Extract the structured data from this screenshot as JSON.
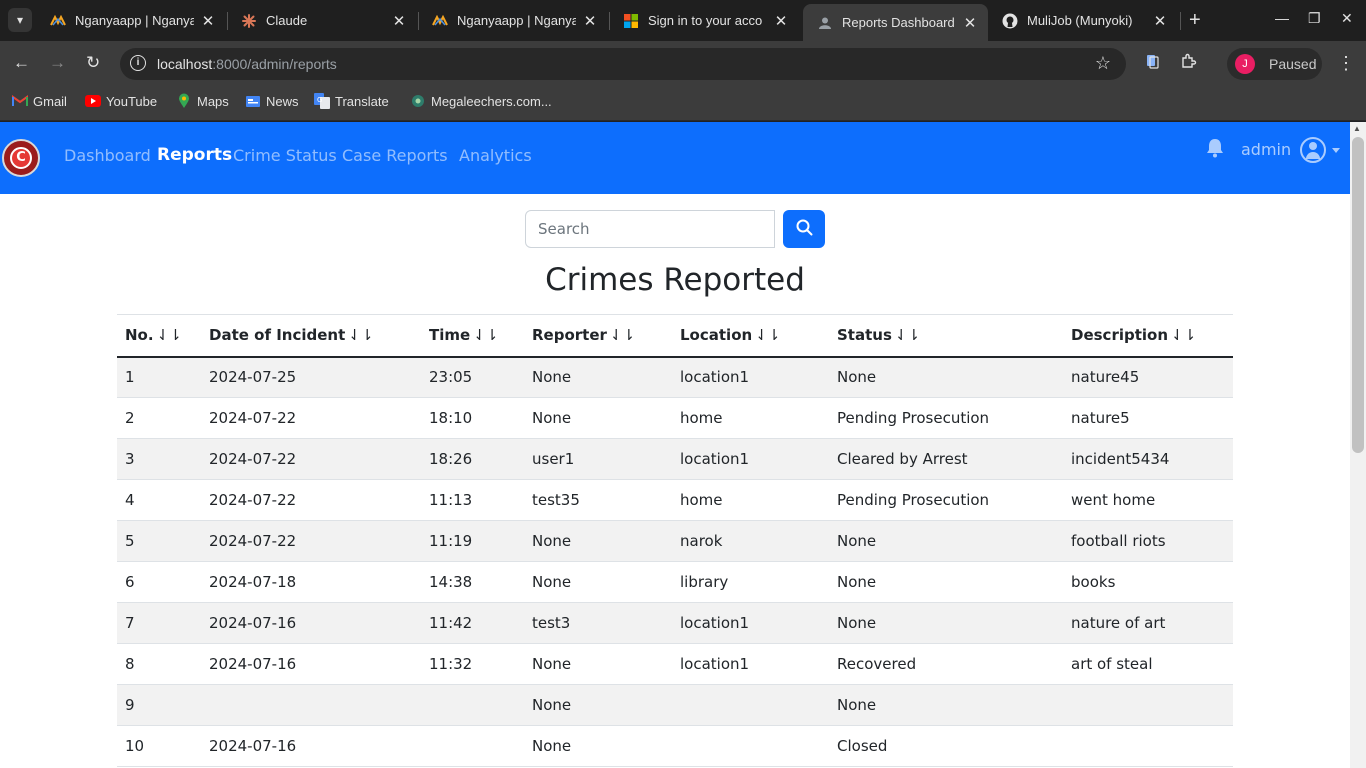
{
  "browser": {
    "tabs": [
      {
        "title": "Nganyaapp | Nganya",
        "favicon": "nganya-icon",
        "active": false
      },
      {
        "title": "Claude",
        "favicon": "claude-icon",
        "active": false
      },
      {
        "title": "Nganyaapp | Nganya",
        "favicon": "nganya-icon",
        "active": false
      },
      {
        "title": "Sign in to your acco",
        "favicon": "microsoft-icon",
        "active": false
      },
      {
        "title": "Reports Dashboard",
        "favicon": "page-icon",
        "active": true
      },
      {
        "title": "MuliJob (Munyoki)",
        "favicon": "github-icon",
        "active": false
      }
    ],
    "url_host": "localhost",
    "url_path": ":8000/admin/reports",
    "profile_initial": "J",
    "profile_label": "Paused",
    "bookmarks": [
      {
        "label": "Gmail",
        "icon": "gmail-icon"
      },
      {
        "label": "YouTube",
        "icon": "youtube-icon"
      },
      {
        "label": "Maps",
        "icon": "maps-icon"
      },
      {
        "label": "News",
        "icon": "news-icon"
      },
      {
        "label": "Translate",
        "icon": "translate-icon"
      },
      {
        "label": "Megaleechers.com...",
        "icon": "megaleechers-icon"
      }
    ]
  },
  "navbar": {
    "logo_letter": "C",
    "links": [
      "Dashboard",
      "Reports",
      "Crime Status",
      "Case Reports",
      "Analytics"
    ],
    "active_link": "Reports",
    "username": "admin",
    "brand_color": "#0d6efd"
  },
  "search": {
    "placeholder": "Search"
  },
  "page": {
    "heading": "Crimes Reported"
  },
  "table": {
    "columns": [
      "No.",
      "Date of Incident",
      "Time",
      "Reporter",
      "Location",
      "Status",
      "Description"
    ],
    "sort_glyph": "⇃⇂",
    "rows": [
      [
        "1",
        "2024-07-25",
        "23:05",
        "None",
        "location1",
        "None",
        "nature45"
      ],
      [
        "2",
        "2024-07-22",
        "18:10",
        "None",
        "home",
        "Pending Prosecution",
        "nature5"
      ],
      [
        "3",
        "2024-07-22",
        "18:26",
        "user1",
        "location1",
        "Cleared by Arrest",
        "incident5434"
      ],
      [
        "4",
        "2024-07-22",
        "11:13",
        "test35",
        "home",
        "Pending Prosecution",
        "went home"
      ],
      [
        "5",
        "2024-07-22",
        "11:19",
        "None",
        "narok",
        "None",
        "football riots"
      ],
      [
        "6",
        "2024-07-18",
        "14:38",
        "None",
        "library",
        "None",
        "books"
      ],
      [
        "7",
        "2024-07-16",
        "11:42",
        "test3",
        "location1",
        "None",
        "nature of art"
      ],
      [
        "8",
        "2024-07-16",
        "11:32",
        "None",
        "location1",
        "Recovered",
        "art of steal"
      ],
      [
        "9",
        "",
        "",
        "None",
        "",
        "None",
        ""
      ],
      [
        "10",
        "2024-07-16",
        "",
        "None",
        "",
        "Closed",
        ""
      ]
    ]
  }
}
